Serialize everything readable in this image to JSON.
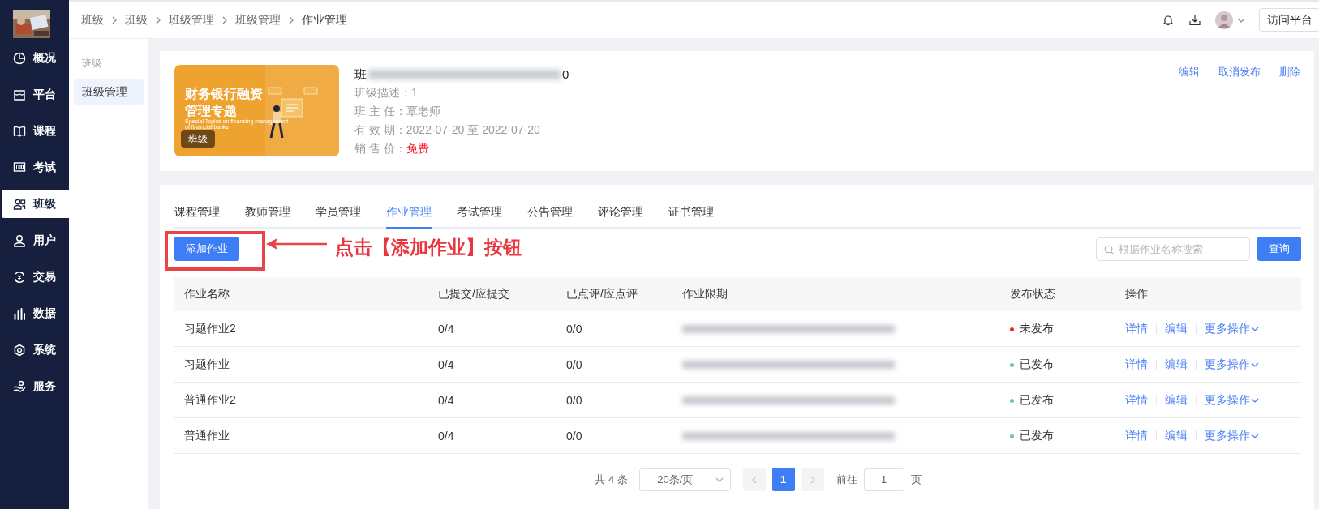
{
  "sidebar": {
    "items": [
      {
        "label": "概况",
        "selected": false
      },
      {
        "label": "平台",
        "selected": false
      },
      {
        "label": "课程",
        "selected": false
      },
      {
        "label": "考试",
        "selected": false
      },
      {
        "label": "班级",
        "selected": true
      },
      {
        "label": "用户",
        "selected": false
      },
      {
        "label": "交易",
        "selected": false
      },
      {
        "label": "数据",
        "selected": false
      },
      {
        "label": "系统",
        "selected": false
      },
      {
        "label": "服务",
        "selected": false
      }
    ]
  },
  "header": {
    "breadcrumb": [
      "班级",
      "班级",
      "班级管理",
      "班级管理",
      "作业管理"
    ],
    "visit_button": "访问平台"
  },
  "subnav": {
    "group": "班级",
    "items": [
      {
        "label": "班级管理",
        "selected": true
      }
    ]
  },
  "class_card": {
    "banner": {
      "title": "财务银行融资管理专题",
      "subtitle": "Special Topics on financing management of financial banks",
      "badge": "班级"
    },
    "title_parts": [
      "班",
      "0"
    ],
    "fields": [
      {
        "kind": "text",
        "label": "班级描述：",
        "value": "1"
      },
      {
        "kind": "text",
        "label": "班 主 任：",
        "value": "覃老师"
      },
      {
        "kind": "text",
        "label": "有 效 期：",
        "value": "2022-07-20 至 2022-07-20"
      },
      {
        "kind": "price",
        "label": "销 售 价：",
        "value": "免费"
      }
    ],
    "actions": [
      "编辑",
      "取消发布",
      "删除"
    ]
  },
  "homework": {
    "tabs": [
      {
        "label": "课程管理",
        "selected": false
      },
      {
        "label": "教师管理",
        "selected": false
      },
      {
        "label": "学员管理",
        "selected": false
      },
      {
        "label": "作业管理",
        "selected": true
      },
      {
        "label": "考试管理",
        "selected": false
      },
      {
        "label": "公告管理",
        "selected": false
      },
      {
        "label": "评论管理",
        "selected": false
      },
      {
        "label": "证书管理",
        "selected": false
      }
    ],
    "add_button": "添加作业",
    "search": {
      "placeholder": "根据作业名称搜索"
    },
    "query_button": "查询",
    "table": {
      "columns": [
        "作业名称",
        "已提交/应提交",
        "已点评/应点评",
        "作业限期",
        "发布状态",
        "操作"
      ],
      "rows": [
        {
          "name": "习题作业2",
          "submitted": "0/4",
          "reviewed": "0/0",
          "status": {
            "text": "未发布",
            "color": "#f5222d"
          },
          "actions": [
            "详情",
            "编辑",
            "更多操作"
          ]
        },
        {
          "name": "习题作业",
          "submitted": "0/4",
          "reviewed": "0/0",
          "status": {
            "text": "已发布",
            "color": "#6acb8a"
          },
          "actions": [
            "详情",
            "编辑",
            "更多操作"
          ]
        },
        {
          "name": "普通作业2",
          "submitted": "0/4",
          "reviewed": "0/0",
          "status": {
            "text": "已发布",
            "color": "#6acb8a"
          },
          "actions": [
            "详情",
            "编辑",
            "更多操作"
          ]
        },
        {
          "name": "普通作业",
          "submitted": "0/4",
          "reviewed": "0/0",
          "status": {
            "text": "已发布",
            "color": "#6acb8a"
          },
          "actions": [
            "详情",
            "编辑",
            "更多操作"
          ]
        }
      ]
    },
    "pagination": {
      "total": "共 4 条",
      "page_size": "20条/页",
      "prev_disabled": true,
      "pages": [
        {
          "label": "1",
          "selected": true
        }
      ],
      "next_disabled": true,
      "goto_label": "前往",
      "goto_value": "1",
      "goto_suffix": "页"
    }
  },
  "annotation": {
    "text": "点击【添加作业】按钮"
  }
}
